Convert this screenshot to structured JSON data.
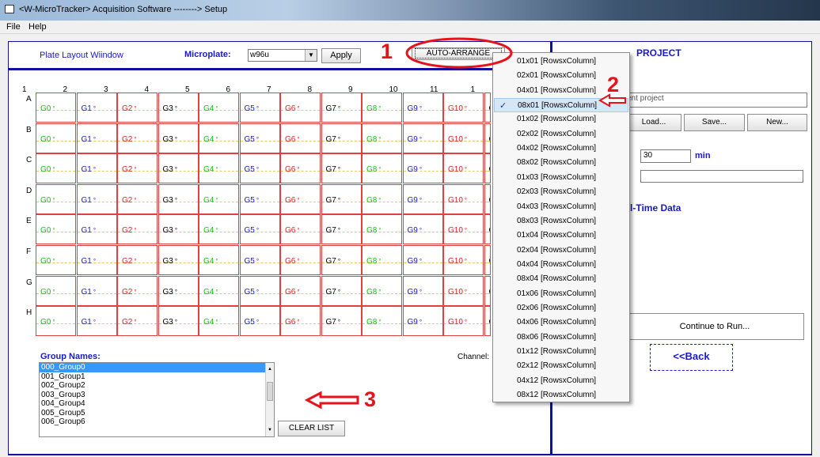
{
  "window": {
    "title": "<W-MicroTracker> Acquisition Software --------> Setup"
  },
  "menu": [
    "File",
    "Help"
  ],
  "plate": {
    "title": "Plate Layout Wiindow",
    "microplate_label": "Microplate:",
    "microplate_value": "w96u",
    "apply_label": "Apply",
    "auto_arrange_label": "AUTO-ARRANGE",
    "columns": [
      "1",
      "2",
      "3",
      "4",
      "5",
      "6",
      "7",
      "8",
      "9",
      "10",
      "11",
      "1"
    ],
    "rows": [
      "A",
      "B",
      "C",
      "D",
      "E",
      "F",
      "G",
      "H"
    ],
    "cell_labels": [
      "G0",
      "G1",
      "G2",
      "G3",
      "G4",
      "G5",
      "G6",
      "G7",
      "G8",
      "G9",
      "G10",
      "G"
    ],
    "cell_dot": "°",
    "cell_colors": [
      "#18c018",
      "#1a1acd",
      "#e02020",
      "#000000",
      "#18c018",
      "#1a1acd",
      "#e02020",
      "#000000",
      "#18c018",
      "#1a1acd",
      "#e02020",
      "#000000"
    ]
  },
  "groups": {
    "title": "Group Names:",
    "items": [
      "000_Group0",
      "001_Group1",
      "002_Group2",
      "003_Group3",
      "004_Group4",
      "005_Group5",
      "006_Group6"
    ],
    "selected_index": 0,
    "clear_label": "CLEAR LIST",
    "channel_label": "Channel:"
  },
  "project": {
    "header": "PROJECT",
    "name_placeholder": "ent project",
    "load_label": "Load...",
    "save_label": "Save...",
    "new_label": "New...",
    "duration_value": "30",
    "duration_unit": "min",
    "realtime_label": "l-Time Data",
    "continue_label": "Continue to Run...",
    "back_label": "<<Back"
  },
  "dropdown": {
    "items": [
      "01x01 [RowsxColumn]",
      "02x01 [RowsxColumn]",
      "04x01 [RowsxColumn]",
      "08x01 [RowsxColumn]",
      "01x02 [RowsxColumn]",
      "02x02 [RowsxColumn]",
      "04x02 [RowsxColumn]",
      "08x02 [RowsxColumn]",
      "01x03 [RowsxColumn]",
      "02x03 [RowsxColumn]",
      "04x03 [RowsxColumn]",
      "08x03 [RowsxColumn]",
      "01x04 [RowsxColumn]",
      "02x04 [RowsxColumn]",
      "04x04 [RowsxColumn]",
      "08x04 [RowsxColumn]",
      "01x06 [RowsxColumn]",
      "02x06 [RowsxColumn]",
      "04x06 [RowsxColumn]",
      "08x06 [RowsxColumn]",
      "01x12 [RowsxColumn]",
      "02x12 [RowsxColumn]",
      "04x12 [RowsxColumn]",
      "08x12 [RowsxColumn]"
    ],
    "selected_index": 3,
    "check": "✓"
  },
  "annotations": {
    "n1": "1",
    "n2": "2",
    "n3": "3",
    "color": "#e8121a"
  }
}
